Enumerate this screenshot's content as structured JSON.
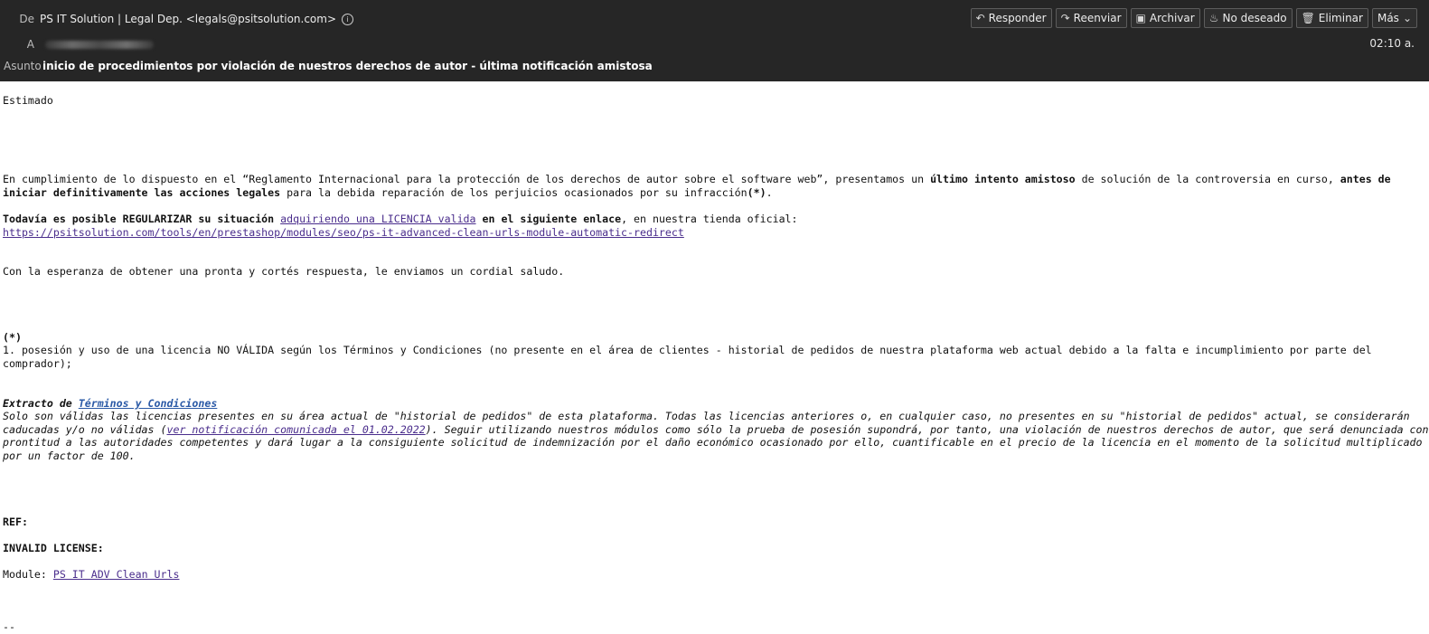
{
  "header": {
    "from_label": "De",
    "from_value": "PS IT Solution | Legal Dep. <legals@psitsolution.com>",
    "to_label": "A",
    "subject_label": "Asunto",
    "subject": "inicio de procedimientos por violación de nuestros derechos de autor - última notificación amistosa",
    "time": "02:10 a."
  },
  "toolbar": {
    "reply": "Responder",
    "forward": "Reenviar",
    "archive": "Archivar",
    "junk": "No deseado",
    "delete": "Eliminar",
    "more": "Más"
  },
  "icons": {
    "reply": "reply-icon",
    "forward": "forward-icon",
    "archive": "archive-icon",
    "junk": "junk-icon",
    "delete": "trash-icon",
    "more": "chevron-down-icon",
    "info": "info-icon"
  },
  "message": {
    "greeting": "Estimado",
    "p1": {
      "t1": "En cumplimiento de lo dispuesto en el “Reglamento Internacional para la protección de los derechos de autor sobre el software web”, presentamos un ",
      "b1": "último intento amistoso",
      "t2": " de solución de la controversia en curso, ",
      "b2": "antes de iniciar definitivamente las acciones legales",
      "t3": " para la debida reparación de los perjuicios ocasionados por su infracción",
      "b3": "(*)",
      "t4": "."
    },
    "p2": {
      "b1": "Todavía es posible REGULARIZAR su situación",
      "t1": " ",
      "link": "adquiriendo una LICENCIA valida",
      "b2": " en el siguiente enlace",
      "t2": ", en nuestra tienda oficial:",
      "url": "https://psitsolution.com/tools/en/prestashop/modules/seo/ps-it-advanced-clean-urls-module-automatic-redirect"
    },
    "closing": "Con la esperanza de obtener una pronta y cortés respuesta, le enviamos un cordial saludo.",
    "note_mark": "(*)",
    "note_text": "1. posesión y uso de una licencia NO VÁLIDA según los Términos y Condiciones (no presente en el área de clientes - historial de pedidos de nuestra plataforma web actual debido a la falta e incumplimiento por parte del comprador);",
    "extract_label": "Extracto de ",
    "extract_link": "Términos y Condiciones",
    "extract": {
      "t1": "Solo son válidas las licencias presentes en su área actual de \"historial de pedidos\" de esta plataforma. Todas las licencias anteriores o, en cualquier caso, no presentes en su \"historial de pedidos\" actual, se considerarán caducadas y/o no válidas (",
      "link": "ver notificación comunicada el 01.02.2022",
      "t2": "). Seguir utilizando nuestros módulos como sólo la prueba de posesión supondrá, por tanto, una violación de nuestros derechos de autor, que será denunciada con prontitud a las autoridades competentes y dará lugar a la consiguiente solicitud de indemnización por el daño económico ocasionado por ello, cuantificable en el precio de la licencia en el momento de la solicitud multiplicado por un factor de 100."
    },
    "ref_label": "REF:",
    "invalid_label": "INVALID LICENSE:",
    "module_label": "Module: ",
    "module_link": "PS IT ADV Clean Urls",
    "signature_sep": "--"
  }
}
